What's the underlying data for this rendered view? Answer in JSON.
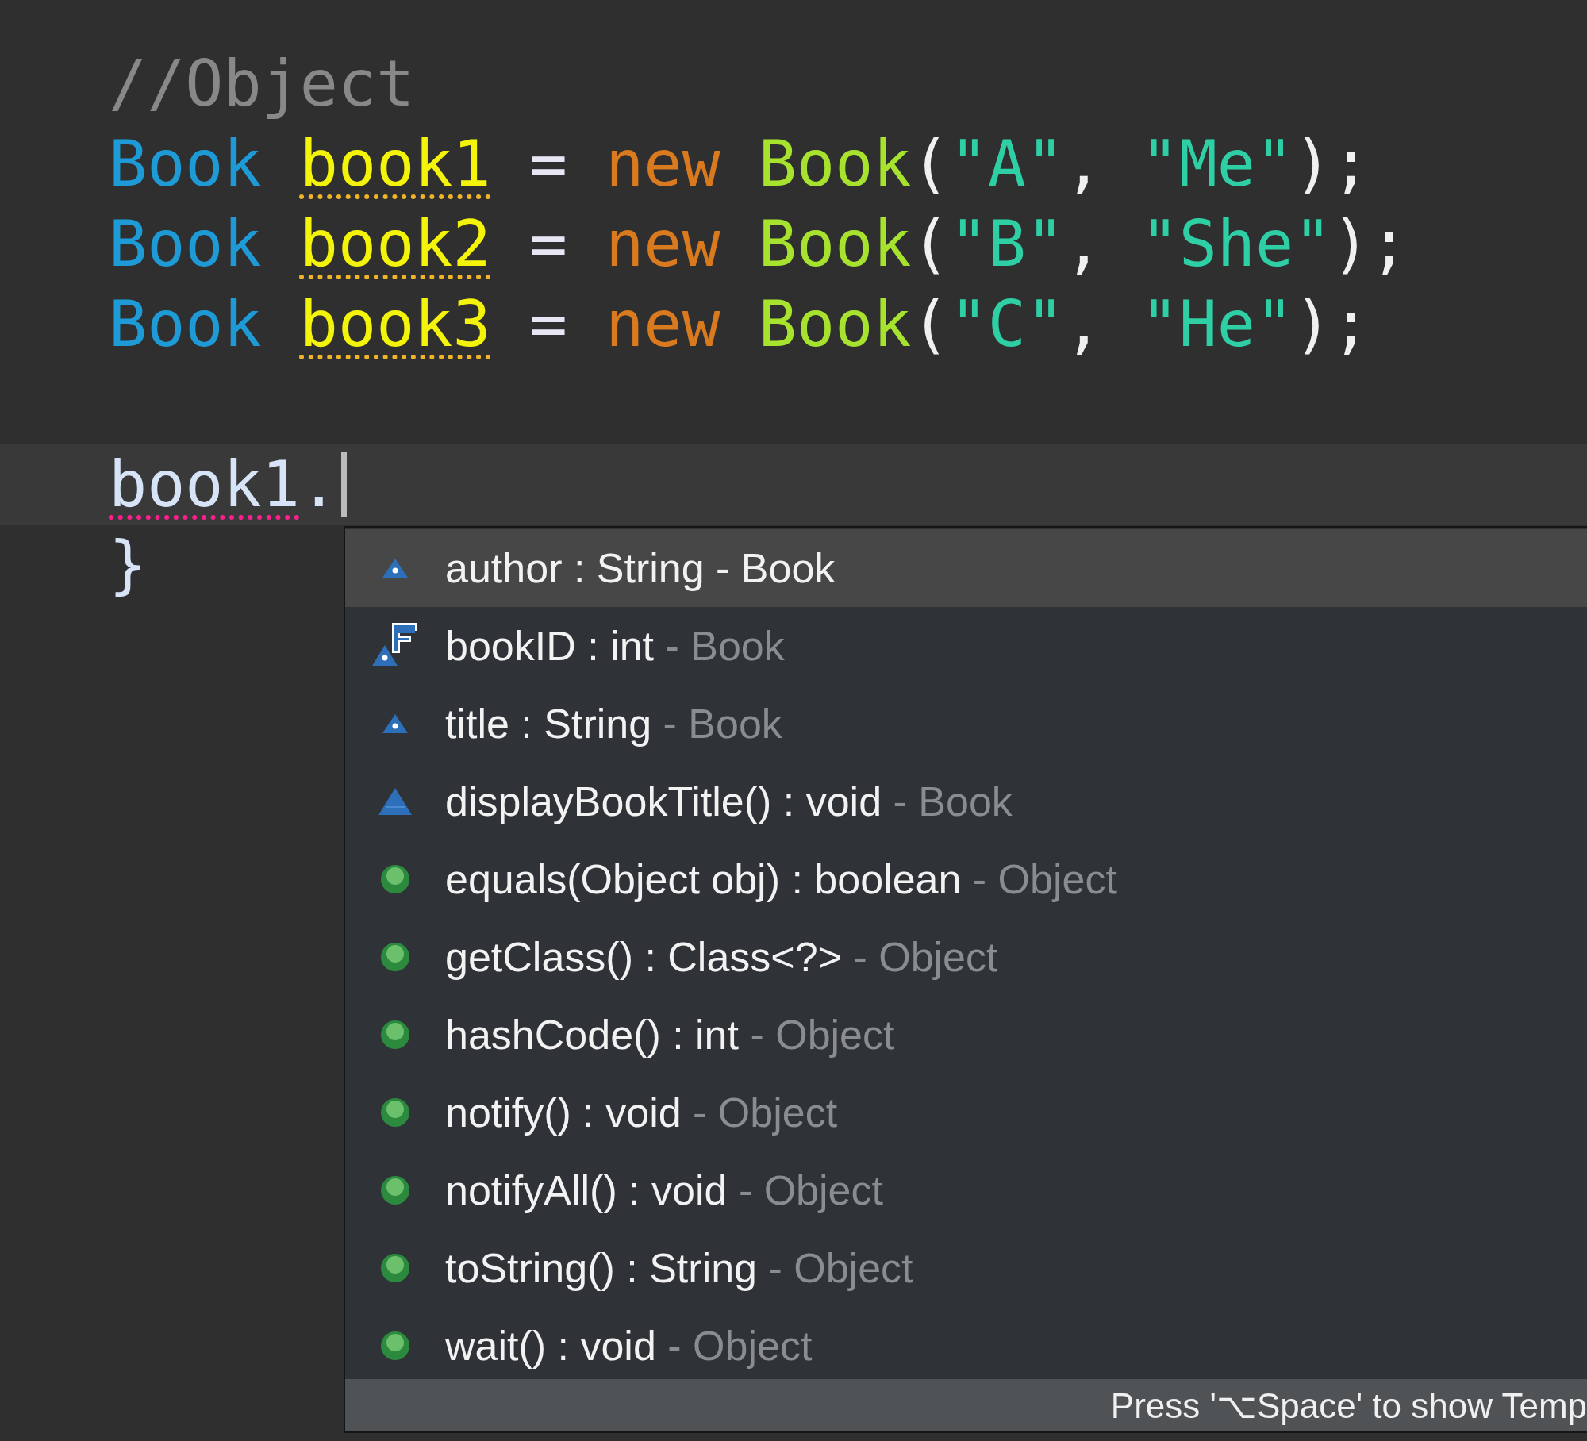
{
  "editor": {
    "lines": [
      {
        "tokens": [
          {
            "kind": "comment",
            "text": "//Object"
          }
        ]
      },
      {
        "tokens": [
          {
            "kind": "type",
            "text": "Book "
          },
          {
            "kind": "variable",
            "text": "book1",
            "warning_underline": true
          },
          {
            "kind": "operator",
            "text": " = "
          },
          {
            "kind": "keyword",
            "text": "new "
          },
          {
            "kind": "constructor",
            "text": "Book"
          },
          {
            "kind": "punct",
            "text": "("
          },
          {
            "kind": "string",
            "text": "\"A\""
          },
          {
            "kind": "punct",
            "text": ", "
          },
          {
            "kind": "string",
            "text": "\"Me\""
          },
          {
            "kind": "punct",
            "text": ");"
          }
        ]
      },
      {
        "tokens": [
          {
            "kind": "type",
            "text": "Book "
          },
          {
            "kind": "variable",
            "text": "book2",
            "warning_underline": true
          },
          {
            "kind": "operator",
            "text": " = "
          },
          {
            "kind": "keyword",
            "text": "new "
          },
          {
            "kind": "constructor",
            "text": "Book"
          },
          {
            "kind": "punct",
            "text": "("
          },
          {
            "kind": "string",
            "text": "\"B\""
          },
          {
            "kind": "punct",
            "text": ", "
          },
          {
            "kind": "string",
            "text": "\"She\""
          },
          {
            "kind": "punct",
            "text": ");"
          }
        ]
      },
      {
        "tokens": [
          {
            "kind": "type",
            "text": "Book "
          },
          {
            "kind": "variable",
            "text": "book3",
            "warning_underline": true
          },
          {
            "kind": "operator",
            "text": " = "
          },
          {
            "kind": "keyword",
            "text": "new "
          },
          {
            "kind": "constructor",
            "text": "Book"
          },
          {
            "kind": "punct",
            "text": "("
          },
          {
            "kind": "string",
            "text": "\"C\""
          },
          {
            "kind": "punct",
            "text": ", "
          },
          {
            "kind": "string",
            "text": "\"He\""
          },
          {
            "kind": "punct",
            "text": ");"
          }
        ]
      },
      {
        "cursor": true,
        "tokens": [
          {
            "kind": "plain",
            "text": "book1",
            "error_underline": true
          },
          {
            "kind": "plain",
            "text": "."
          }
        ]
      },
      {
        "tokens": [
          {
            "kind": "plain",
            "text": "}"
          }
        ]
      }
    ]
  },
  "completion": {
    "items": [
      {
        "kind": "field",
        "label": "author : String",
        "source": "- Book",
        "selected": true
      },
      {
        "kind": "constant",
        "label": "bookID : int",
        "source": "- Book",
        "selected": false
      },
      {
        "kind": "field",
        "label": "title : String",
        "source": "- Book",
        "selected": false
      },
      {
        "kind": "method",
        "label": "displayBookTitle() : void",
        "source": "- Book",
        "selected": false
      },
      {
        "kind": "inherited",
        "label": "equals(Object obj) : boolean",
        "source": "- Object",
        "selected": false
      },
      {
        "kind": "inherited",
        "label": "getClass() : Class<?>",
        "source": "- Object",
        "selected": false
      },
      {
        "kind": "inherited",
        "label": "hashCode() : int",
        "source": "- Object",
        "selected": false
      },
      {
        "kind": "inherited",
        "label": "notify() : void",
        "source": "- Object",
        "selected": false
      },
      {
        "kind": "inherited",
        "label": "notifyAll() : void",
        "source": "- Object",
        "selected": false
      },
      {
        "kind": "inherited",
        "label": "toString() : String",
        "source": "- Object",
        "selected": false
      },
      {
        "kind": "inherited",
        "label": "wait() : void",
        "source": "- Object",
        "selected": false
      }
    ],
    "hint": "Press '⌥Space' to show Temp"
  }
}
